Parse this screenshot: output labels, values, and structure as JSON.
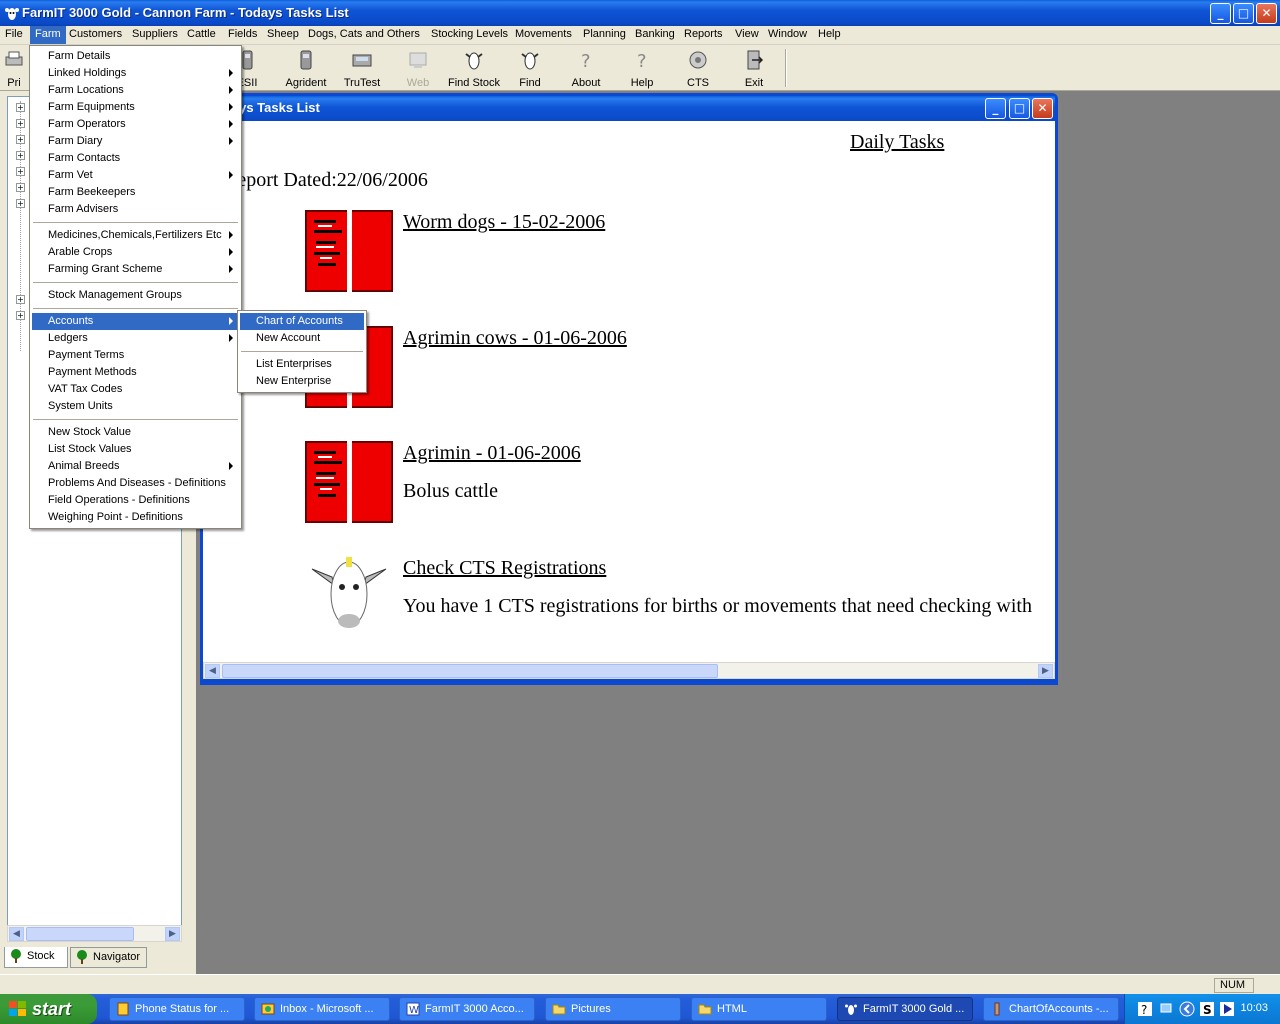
{
  "window": {
    "title": "FarmIT 3000 Gold - Cannon Farm - Todays Tasks List",
    "min": "_",
    "max": "□",
    "close": "✕"
  },
  "menubar": [
    "File",
    "Farm",
    "Customers",
    "Suppliers",
    "Cattle",
    "Fields",
    "Sheep",
    "Dogs, Cats and Others",
    "Stocking Levels",
    "Movements",
    "Planning",
    "Banking",
    "Reports",
    "View",
    "Window",
    "Help"
  ],
  "toolbar": {
    "items": [
      "Pri",
      "ESII",
      "Agrident",
      "TruTest",
      "Web",
      "Find Stock",
      "Find",
      "About",
      "Help",
      "CTS",
      "Exit"
    ]
  },
  "farm_menu": {
    "items": [
      {
        "label": "Farm Details",
        "sub": false
      },
      {
        "label": "Linked Holdings",
        "sub": true
      },
      {
        "label": "Farm Locations",
        "sub": true
      },
      {
        "label": "Farm Equipments",
        "sub": true
      },
      {
        "label": "Farm Operators",
        "sub": true
      },
      {
        "label": "Farm Diary",
        "sub": true
      },
      {
        "label": "Farm Contacts",
        "sub": false
      },
      {
        "label": "Farm Vet",
        "sub": true
      },
      {
        "label": "Farm Beekeepers",
        "sub": false
      },
      {
        "label": "Farm Advisers",
        "sub": false
      },
      {
        "label": "Medicines,Chemicals,Fertilizers Etc",
        "sub": true
      },
      {
        "label": "Arable Crops",
        "sub": true
      },
      {
        "label": "Farming Grant Scheme",
        "sub": true
      },
      {
        "label": "Stock Management Groups",
        "sub": false
      },
      {
        "label": "Accounts",
        "sub": true
      },
      {
        "label": "Ledgers",
        "sub": true
      },
      {
        "label": "Payment Terms",
        "sub": false
      },
      {
        "label": "Payment Methods",
        "sub": false
      },
      {
        "label": "VAT Tax Codes",
        "sub": false
      },
      {
        "label": "System Units",
        "sub": false
      },
      {
        "label": "New Stock Value",
        "sub": false
      },
      {
        "label": "List Stock Values",
        "sub": false
      },
      {
        "label": "Animal Breeds",
        "sub": true
      },
      {
        "label": "Problems And Diseases - Definitions",
        "sub": false
      },
      {
        "label": "Field Operations - Definitions",
        "sub": false
      },
      {
        "label": "Weighing Point - Definitions",
        "sub": false
      }
    ]
  },
  "accounts_submenu": {
    "items": [
      "Chart of Accounts",
      "New Account",
      "List Enterprises",
      "New Enterprise"
    ]
  },
  "child_window": {
    "title": "Todays Tasks List",
    "heading": "Daily Tasks",
    "report_dated": "Report Dated:22/06/2006",
    "tasks": [
      {
        "link": "Worm dogs - 15-02-2006",
        "desc": ""
      },
      {
        "link": "Agrimin cows - 01-06-2006",
        "desc": ""
      },
      {
        "link": "Agrimin - 01-06-2006",
        "desc": "Bolus cattle"
      },
      {
        "link": "Check CTS Registrations",
        "desc": "You have 1 CTS registrations for births or movements that need checking with"
      }
    ]
  },
  "left_panel": {
    "tabs": [
      "Stock",
      "Navigator"
    ]
  },
  "statusbar": {
    "num": "NUM"
  },
  "taskbar": {
    "start": "start",
    "buttons": [
      "Phone Status for ...",
      "Inbox - Microsoft ...",
      "FarmIT 3000 Acco...",
      "Pictures",
      "HTML",
      "FarmIT 3000 Gold ...",
      "ChartOfAccounts -..."
    ],
    "clock": "10:03"
  },
  "colors": {
    "accent": "#316ac5",
    "titlebar": "#0a49c8",
    "book": "#e00000"
  }
}
